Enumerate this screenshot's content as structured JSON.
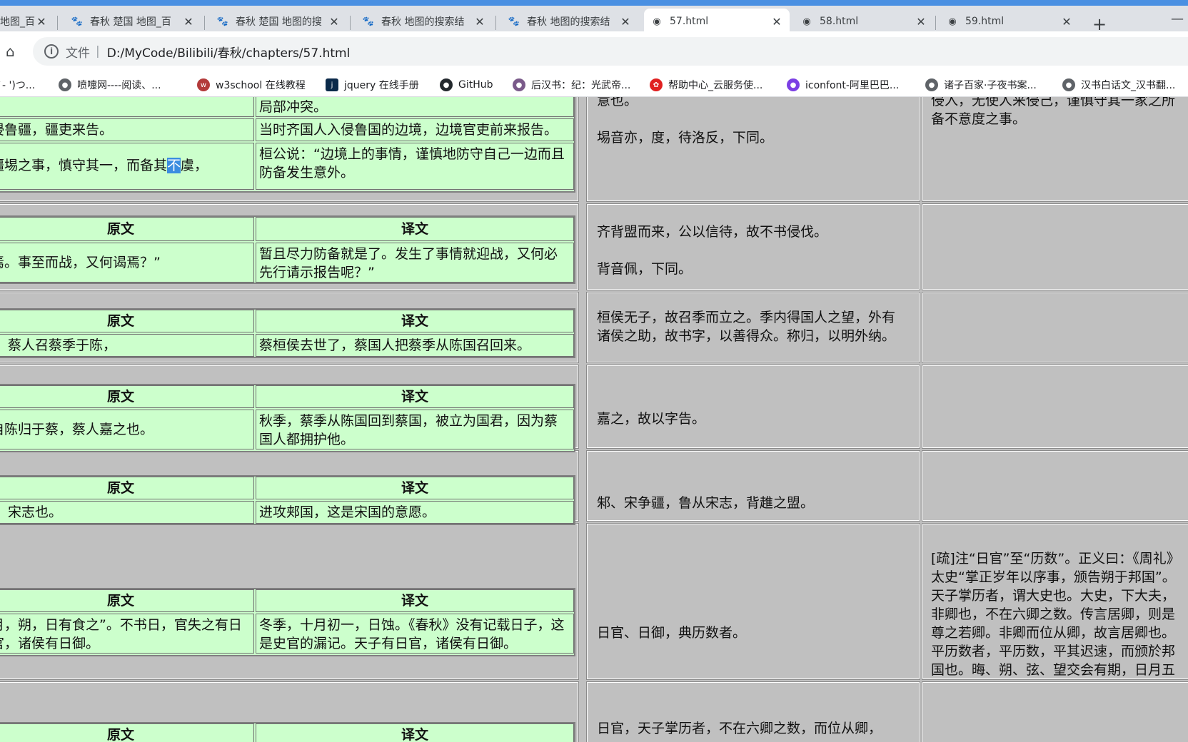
{
  "tabs": [
    {
      "title": "地图_百",
      "active": false
    },
    {
      "title": "春秋 楚国 地图_百",
      "active": false
    },
    {
      "title": "春秋 楚国 地图的搜",
      "active": false
    },
    {
      "title": "春秋 地图的搜索结",
      "active": false
    },
    {
      "title": "春秋 地图的搜索结",
      "active": false
    },
    {
      "title": "57.html",
      "active": true
    },
    {
      "title": "58.html",
      "active": false
    },
    {
      "title": "59.html",
      "active": false
    }
  ],
  "address": {
    "scheme_label": "文件",
    "url": "D:/MyCode/Bilibili/春秋/chapters/57.html"
  },
  "bookmarks": [
    {
      "label": "`- ')つ...",
      "icon": "emoji-icon"
    },
    {
      "label": "喷嚏网----阅读、...",
      "icon": "globe-icon"
    },
    {
      "label": "w3school 在线教程",
      "icon": "w3school-icon"
    },
    {
      "label": "jquery 在线手册",
      "icon": "jquery-icon"
    },
    {
      "label": "GitHub",
      "icon": "github-icon"
    },
    {
      "label": "后汉书：纪：光武帝...",
      "icon": "ctext-icon"
    },
    {
      "label": "帮助中心_云服务使...",
      "icon": "huawei-icon"
    },
    {
      "label": "iconfont-阿里巴巴...",
      "icon": "iconfont-icon"
    },
    {
      "label": "诸子百家·子夜书案...",
      "icon": "globe-icon"
    },
    {
      "label": "汉书白话文_汉书翻...",
      "icon": "globe-icon"
    }
  ],
  "labels": {
    "original": "原文",
    "translation": "译文"
  },
  "rows": [
    {
      "lines": [
        {
          "orig": "",
          "trans": "局部冲突。"
        },
        {
          "orig": "侵鲁疆，疆吏来告。",
          "trans": "当时齐国人入侵鲁国的边境，边境官吏前来报告。"
        },
        {
          "orig_pre": "疆埸之事，慎守其一，而备其",
          "orig_hl": "不",
          "orig_post": "虞，",
          "trans": "桓公说：“边境上的事情，谨慎地防守自己一边而且防备发生意外。"
        }
      ],
      "note": [
        "意也。",
        "",
        "埸音亦，度，待洛反，下同。"
      ],
      "note2": "侵入，无使人来侵己，谨慎守其一家之所备不意度之事。"
    },
    {
      "orig": "焉。事至而战，又何谒焉？”",
      "trans": "暂且尽力防备就是了。发生了事情就迎战，又何必先行请示报告呢？”",
      "note": [
        "齐背盟而来，公以信待，故不书侵伐。",
        "",
        "背音佩，下同。"
      ]
    },
    {
      "orig": "蔡人召蔡季于陈，",
      "trans": "蔡桓侯去世了，蔡国人把蔡季从陈国召回来。",
      "note": [
        "桓侯无子，故召季而立之。季内得国人之望，外有诸侯之助，故书字，以善得众。称归，以明外纳。"
      ]
    },
    {
      "orig": "自陈归于蔡，蔡人嘉之也。",
      "trans": "秋季，蔡季从陈国回到蔡国，被立为国君，因为蔡国人都拥护他。",
      "note": [
        "嘉之，故以字告。"
      ]
    },
    {
      "orig": "宋志也。",
      "trans": "进攻郏国，这是宋国的意愿。",
      "note": [
        "邾、宋争疆，鲁从宋志，背趡之盟。"
      ]
    },
    {
      "orig": "月，朔，日有食之”。不书日，官失之有日官，诸侯有日御。",
      "trans": "冬季，十月初一，日蚀。《春秋》没有记载日子，这是史官的漏记。天子有日官，诸侯有日御。",
      "note": [
        "日官、日御，典历数者。"
      ],
      "note2": "[疏]注“日官”至“历数”。正义曰：《周礼》太史“掌正岁年以序事，颁告朔于邦国”。天子掌历者，谓大史也。大史，下大夫，非卿也，不在六卿之数。传言居卿，则是尊之若卿。非卿而位从卿，故言居卿也。平历数者，平历数，平其迟速，而颁於邦国也。晦、朔、弦、望交会有期，日月五星行道有度，历而数之，故曰：“历数也。"
    },
    {
      "orig": "",
      "trans": "",
      "note": [
        "日官，天子掌历者，不在六卿之数，而位从卿，"
      ]
    }
  ]
}
